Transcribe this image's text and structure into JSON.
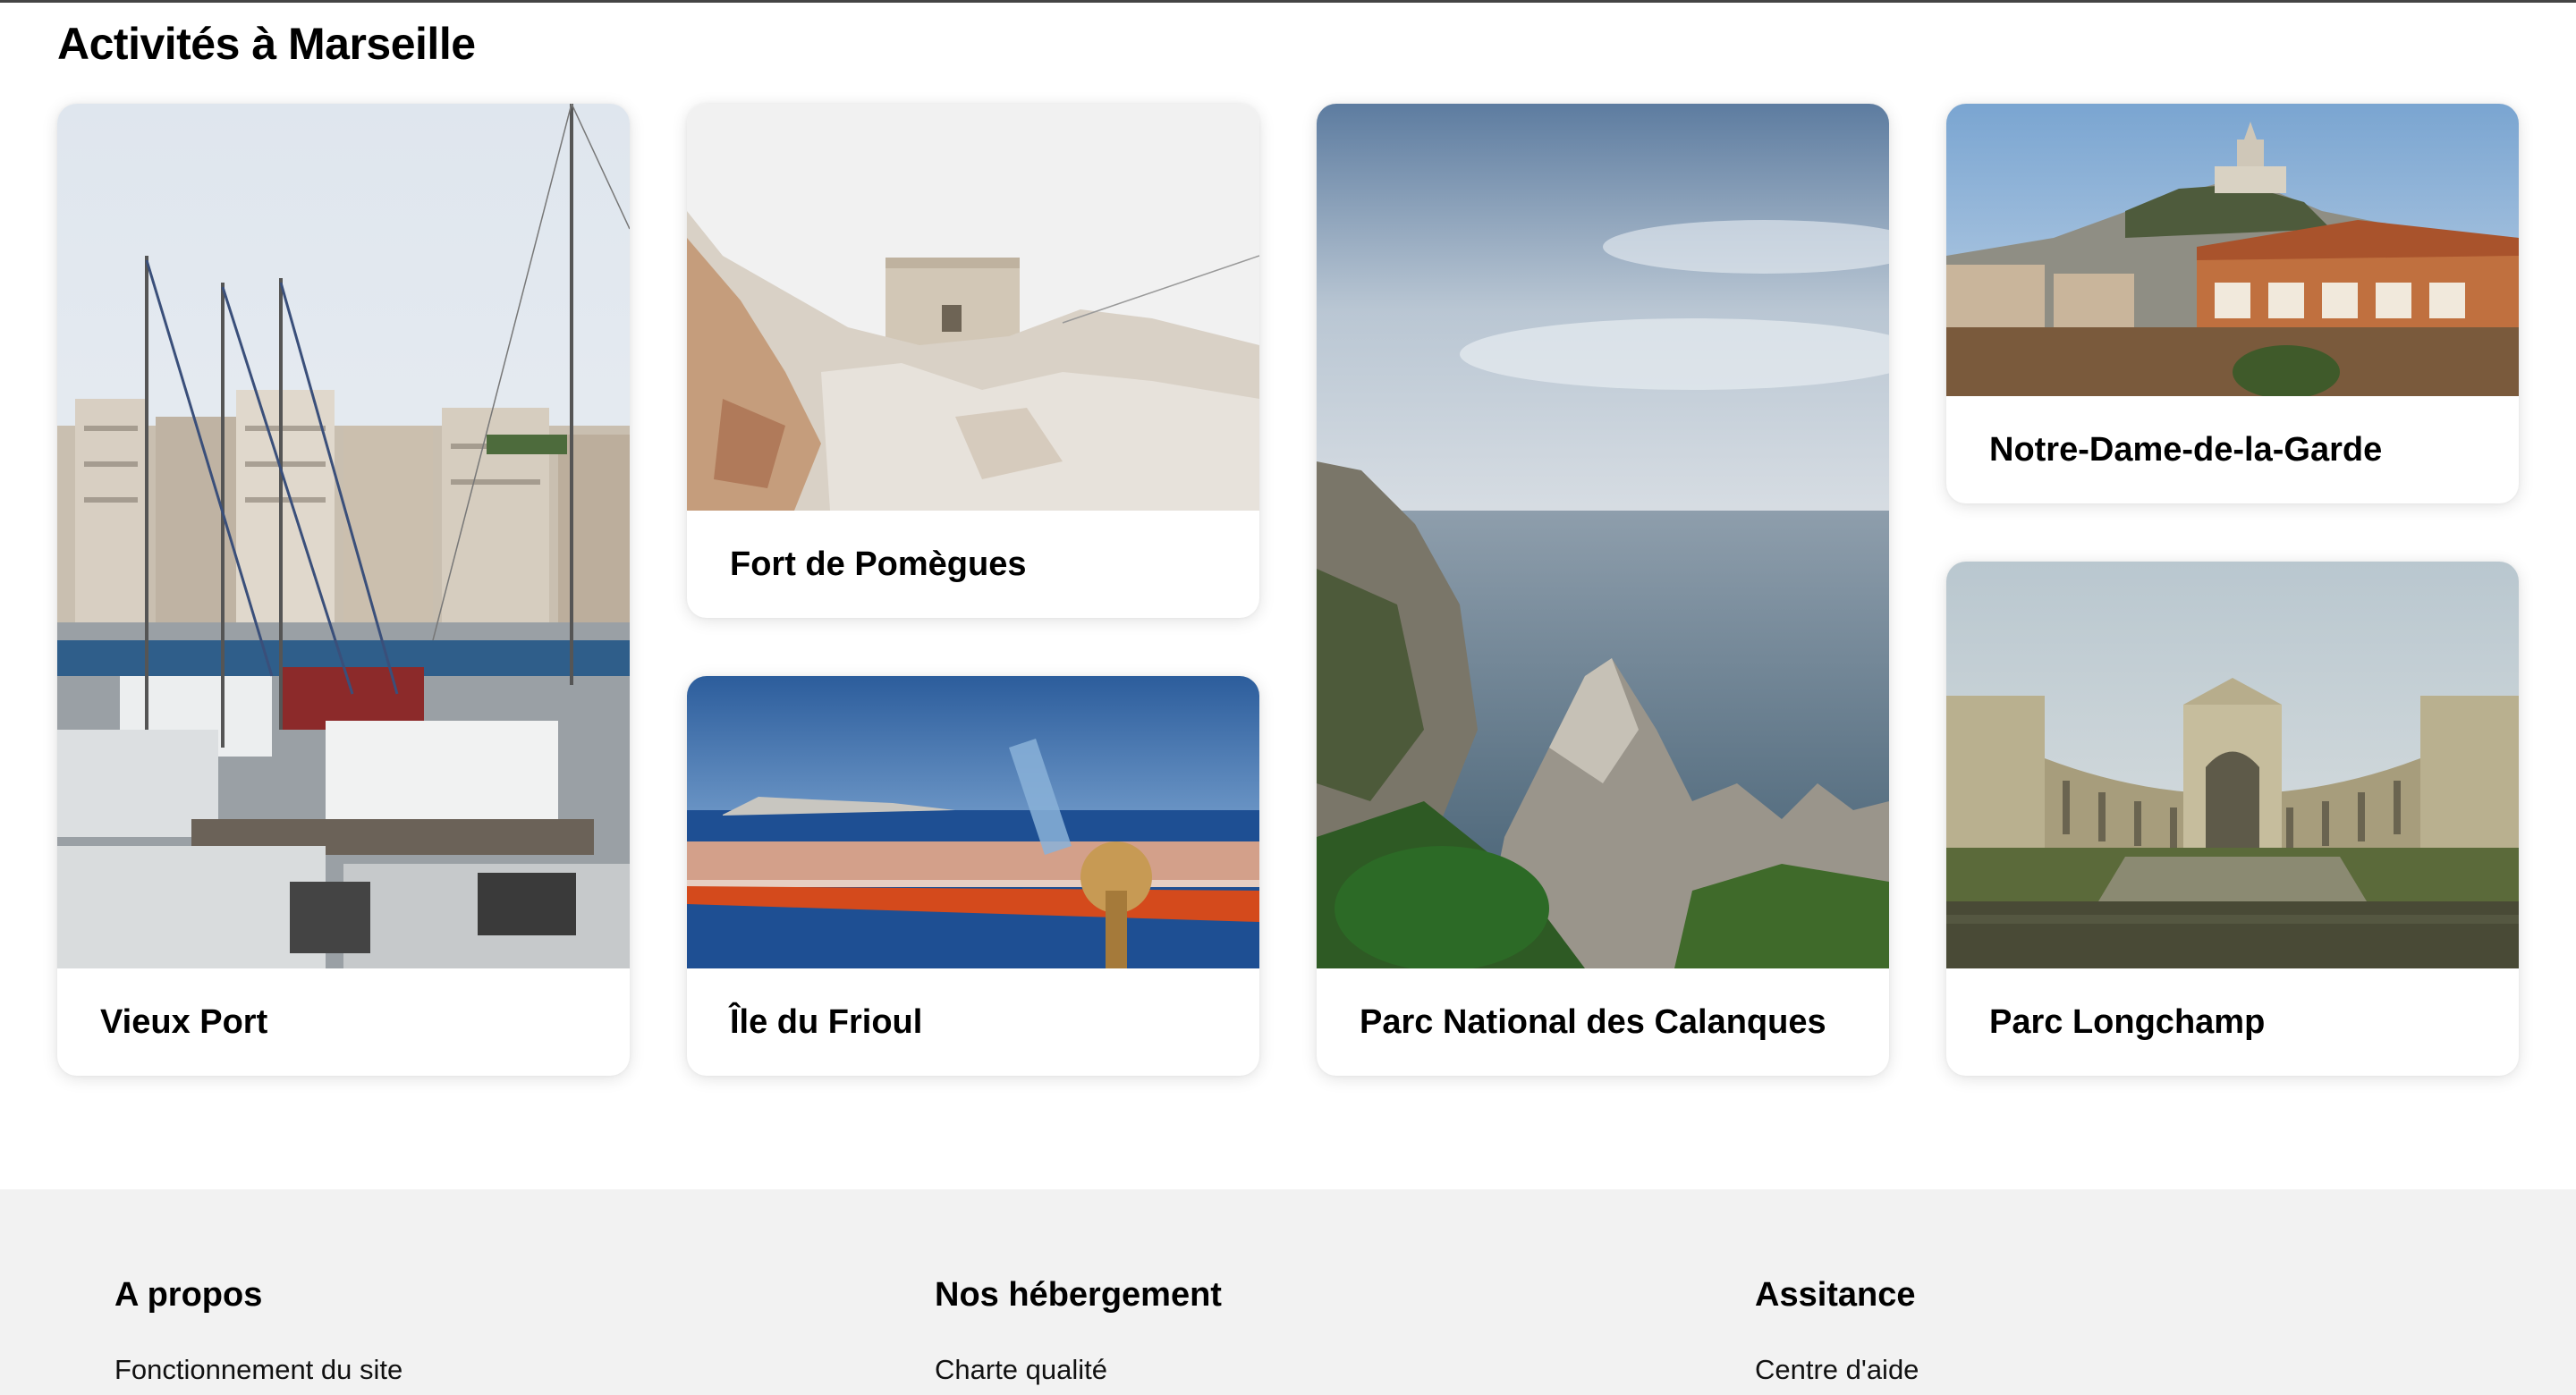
{
  "section": {
    "title": "Activités à Marseille"
  },
  "cards": [
    {
      "name": "Vieux Port",
      "image": "harbor-photo"
    },
    {
      "name": "Fort de Pomègues",
      "image": "fort-photo"
    },
    {
      "name": "Île du Frioul",
      "image": "island-photo"
    },
    {
      "name": "Parc National des Calanques",
      "image": "calanques-photo"
    },
    {
      "name": "Notre-Dame-de-la-Garde",
      "image": "basilica-photo"
    },
    {
      "name": "Parc Longchamp",
      "image": "palace-photo"
    }
  ],
  "footer": {
    "columns": [
      {
        "heading": "A propos",
        "links": [
          "Fonctionnement du site"
        ]
      },
      {
        "heading": "Nos hébergement",
        "links": [
          "Charte qualité"
        ]
      },
      {
        "heading": "Assitance",
        "links": [
          "Centre d'aide"
        ]
      }
    ]
  },
  "colors": {
    "footer_bg": "#f2f2f2",
    "card_bg": "#ffffff",
    "text": "#000000"
  }
}
